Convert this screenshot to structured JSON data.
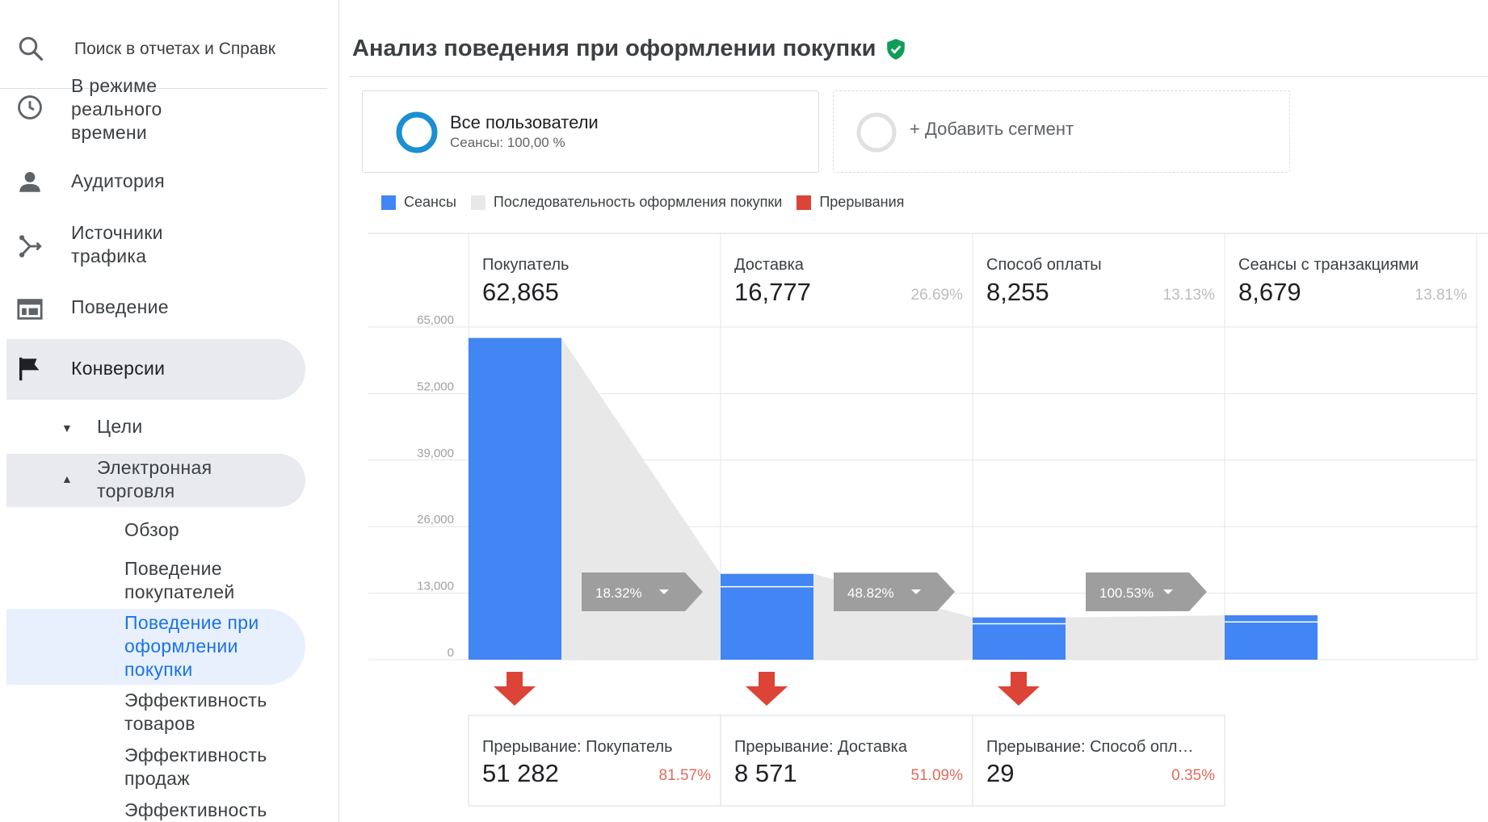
{
  "sidebar": {
    "search_placeholder": "Поиск в отчетах и Справк",
    "items": [
      {
        "label": "В режиме реального времени",
        "icon": "clock-icon"
      },
      {
        "label": "Аудитория",
        "icon": "person-icon"
      },
      {
        "label": "Источники трафика",
        "icon": "acquisition-icon"
      },
      {
        "label": "Поведение",
        "icon": "behavior-window-icon"
      },
      {
        "label": "Конверсии",
        "icon": "flag-icon"
      }
    ],
    "goals_label": "Цели",
    "ecommerce_label": "Электронная торговля",
    "sub_items": [
      "Обзор",
      "Поведение покупателей",
      "Поведение при оформлении покупки",
      "Эффективность товаров",
      "Эффективность продаж",
      "Эффективность"
    ]
  },
  "main": {
    "title": "Анализ поведения при оформлении покупки",
    "segment_all": {
      "name": "Все пользователи",
      "sub": "Сеансы: 100,00 %"
    },
    "segment_add": "+ Добавить сегмент",
    "legend": [
      {
        "label": "Сеансы",
        "color": "#4285f4"
      },
      {
        "label": "Последовательность оформления покупки",
        "color": "#e8e8e8"
      },
      {
        "label": "Прерывания",
        "color": "#db4437"
      }
    ]
  },
  "chart_data": {
    "type": "bar",
    "y_ticks": [
      "65,000",
      "52,000",
      "39,000",
      "26,000",
      "13,000",
      "0"
    ],
    "ylim": [
      0,
      65000
    ],
    "steps": [
      {
        "name": "Покупатель",
        "value_label": "62,865",
        "value": 62865,
        "pct": ""
      },
      {
        "name": "Доставка",
        "value_label": "16,777",
        "value": 16777,
        "pct": "26.69%"
      },
      {
        "name": "Способ оплаты",
        "value_label": "8,255",
        "value": 8255,
        "pct": "13.13%"
      },
      {
        "name": "Сеансы с транзакциями",
        "value_label": "8,679",
        "value": 8679,
        "pct": "13.81%"
      }
    ],
    "conversions": [
      "18.32%",
      "48.82%",
      "100.53%"
    ],
    "abandonments": [
      {
        "label": "Прерывание: Покупатель",
        "value_label": "51 282",
        "pct": "81.57%"
      },
      {
        "label": "Прерывание: Доставка",
        "value_label": "8 571",
        "pct": "51.09%"
      },
      {
        "label": "Прерывание: Способ опл…",
        "value_label": "29",
        "pct": "0.35%"
      }
    ],
    "colors": {
      "sessions": "#4285f4",
      "flow": "#e8e8e8",
      "abandon": "#db4437",
      "pct_red": "#e06a5e"
    }
  }
}
